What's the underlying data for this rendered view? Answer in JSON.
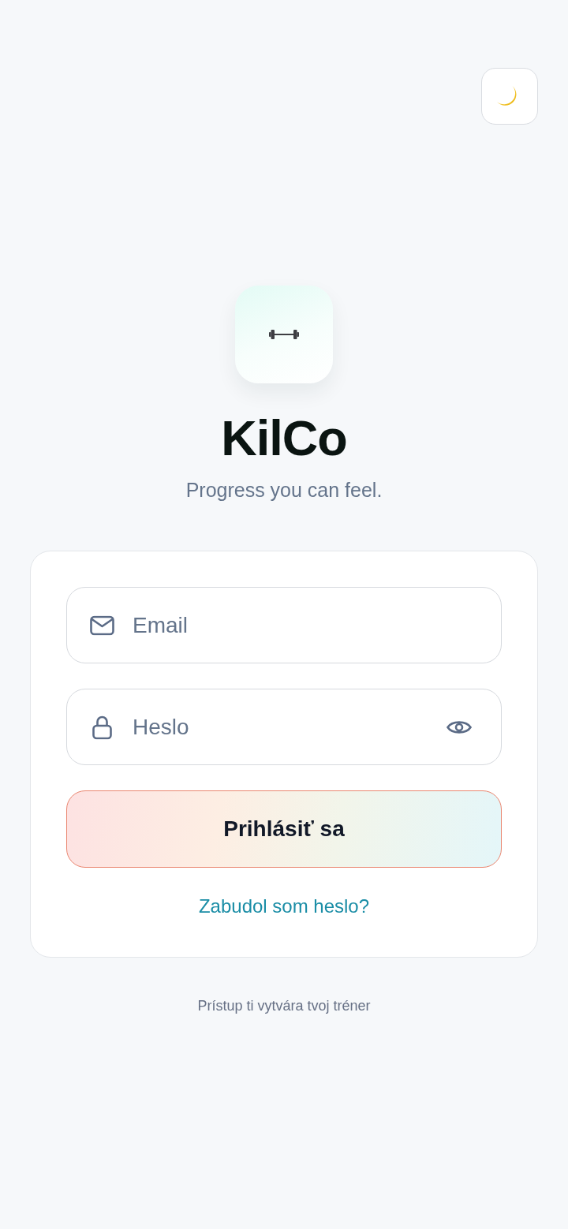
{
  "brand": {
    "name": "KilCo",
    "tagline": "Progress you can feel."
  },
  "login_form": {
    "fields": [
      {
        "kind": "email",
        "placeholder": "Email"
      },
      {
        "kind": "password",
        "placeholder": "Heslo"
      }
    ],
    "submit_button": {
      "label": "Prihlásiť sa"
    },
    "forgot_link": {
      "label": "Zabudol som heslo?"
    }
  },
  "footer": {
    "note": "Prístup ti vytvára tvoj tréner"
  }
}
